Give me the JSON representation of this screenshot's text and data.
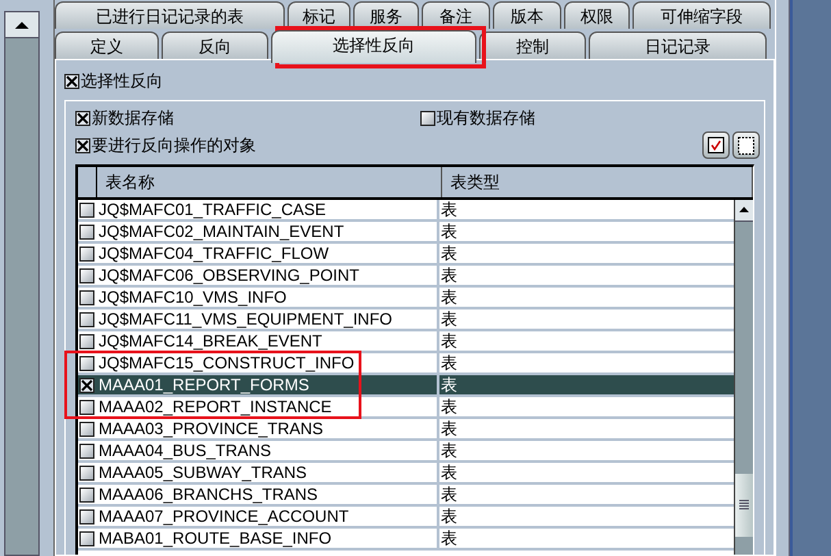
{
  "tabs_row_1": [
    {
      "label": "已进行日记记录的表",
      "selected": false
    },
    {
      "label": "标记",
      "selected": false
    },
    {
      "label": "服务",
      "selected": false
    },
    {
      "label": "备注",
      "selected": false
    },
    {
      "label": "版本",
      "selected": false
    },
    {
      "label": "权限",
      "selected": false
    },
    {
      "label": "可伸缩字段",
      "selected": false
    }
  ],
  "tabs_row_2": [
    {
      "label": "定义",
      "selected": false
    },
    {
      "label": "反向",
      "selected": false
    },
    {
      "label": "选择性反向",
      "selected": true
    },
    {
      "label": "控制",
      "selected": false
    },
    {
      "label": "日记记录",
      "selected": false
    }
  ],
  "selective_reverse": {
    "label": "选择性反向",
    "checked": true
  },
  "options": [
    {
      "label": "新数据存储",
      "checked": true
    },
    {
      "label": "现有数据存储",
      "checked": false
    },
    {
      "label": "要进行反向操作的对象",
      "checked": true
    }
  ],
  "table": {
    "columns": [
      "表名称",
      "表类型"
    ],
    "rows": [
      {
        "name": "JQ$MAFC01_TRAFFIC_CASE",
        "type": "表",
        "checked": false,
        "selected": false
      },
      {
        "name": "JQ$MAFC02_MAINTAIN_EVENT",
        "type": "表",
        "checked": false,
        "selected": false
      },
      {
        "name": "JQ$MAFC04_TRAFFIC_FLOW",
        "type": "表",
        "checked": false,
        "selected": false
      },
      {
        "name": "JQ$MAFC06_OBSERVING_POINT",
        "type": "表",
        "checked": false,
        "selected": false
      },
      {
        "name": "JQ$MAFC10_VMS_INFO",
        "type": "表",
        "checked": false,
        "selected": false
      },
      {
        "name": "JQ$MAFC11_VMS_EQUIPMENT_INFO",
        "type": "表",
        "checked": false,
        "selected": false
      },
      {
        "name": "JQ$MAFC14_BREAK_EVENT",
        "type": "表",
        "checked": false,
        "selected": false
      },
      {
        "name": "JQ$MAFC15_CONSTRUCT_INFO",
        "type": "表",
        "checked": false,
        "selected": false
      },
      {
        "name": "MAAA01_REPORT_FORMS",
        "type": "表",
        "checked": true,
        "selected": true
      },
      {
        "name": "MAAA02_REPORT_INSTANCE",
        "type": "表",
        "checked": false,
        "selected": false
      },
      {
        "name": "MAAA03_PROVINCE_TRANS",
        "type": "表",
        "checked": false,
        "selected": false
      },
      {
        "name": "MAAA04_BUS_TRANS",
        "type": "表",
        "checked": false,
        "selected": false
      },
      {
        "name": "MAAA05_SUBWAY_TRANS",
        "type": "表",
        "checked": false,
        "selected": false
      },
      {
        "name": "MAAA06_BRANCHS_TRANS",
        "type": "表",
        "checked": false,
        "selected": false
      },
      {
        "name": "MAAA07_PROVINCE_ACCOUNT",
        "type": "表",
        "checked": false,
        "selected": false
      },
      {
        "name": "MABA01_ROUTE_BASE_INFO",
        "type": "表",
        "checked": false,
        "selected": false
      }
    ]
  }
}
